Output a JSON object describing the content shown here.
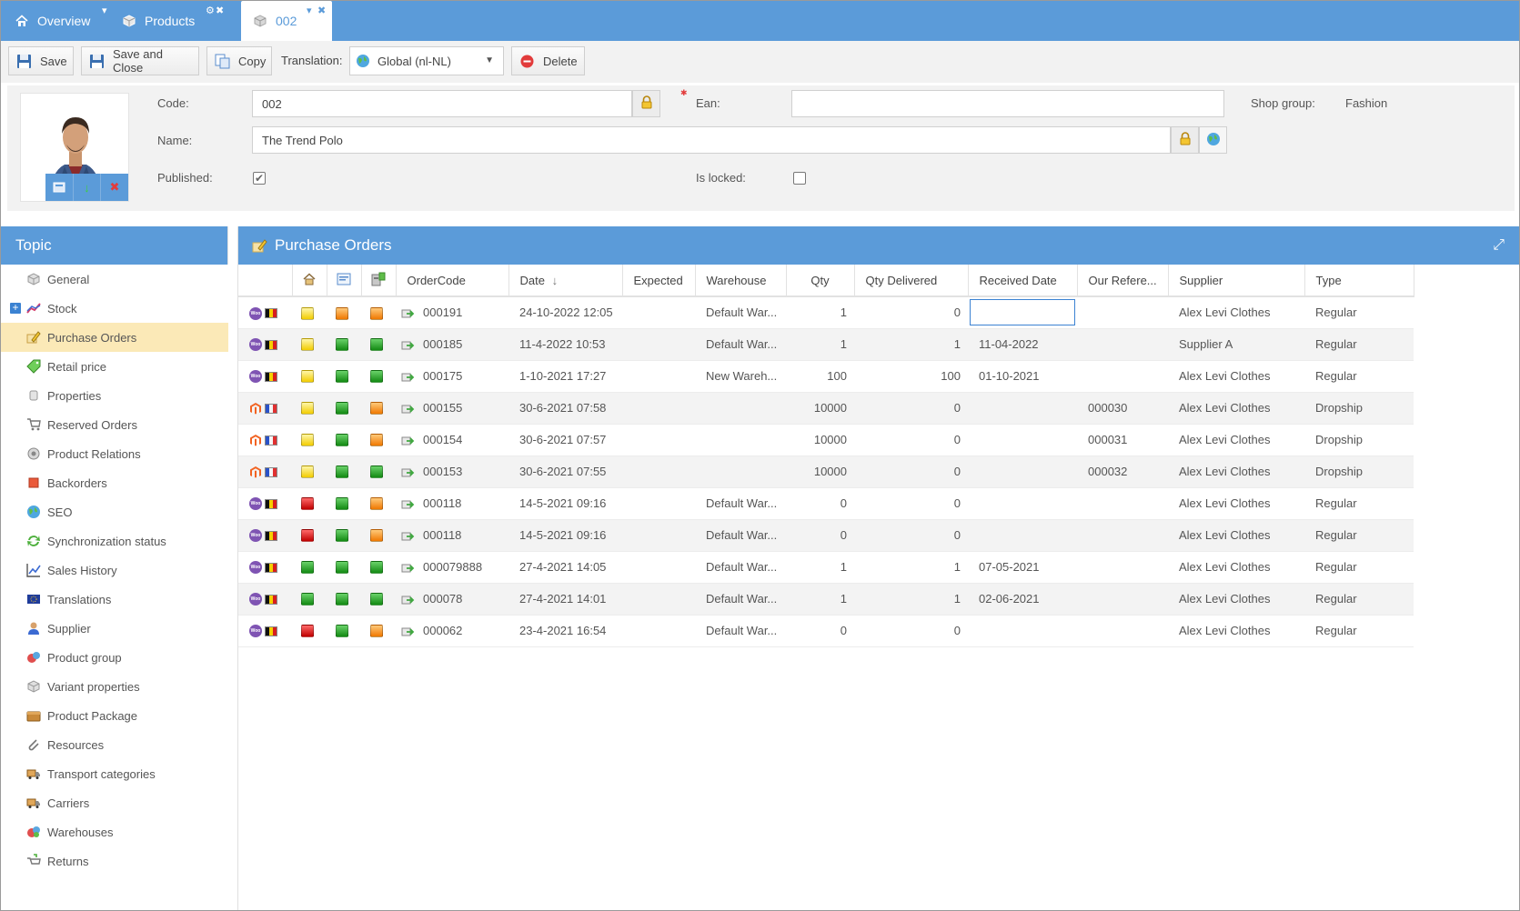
{
  "tabs": [
    {
      "label": "Overview",
      "icon": "home-icon"
    },
    {
      "label": "Products",
      "icon": "box-icon"
    },
    {
      "label": "002",
      "icon": "box-icon"
    }
  ],
  "toolbar": {
    "save_label": "Save",
    "save_close_label": "Save and Close",
    "copy_label": "Copy",
    "translation_label": "Translation:",
    "translation_value": "Global (nl-NL)",
    "delete_label": "Delete"
  },
  "product": {
    "code_label": "Code:",
    "code_value": "002",
    "ean_label": "Ean:",
    "ean_value": "",
    "shop_group_label": "Shop group:",
    "shop_group_value": "Fashion",
    "name_label": "Name:",
    "name_value": "The Trend Polo",
    "published_label": "Published:",
    "published_checked": true,
    "is_locked_label": "Is locked:",
    "is_locked_checked": false
  },
  "topic": {
    "title": "Topic",
    "items": [
      {
        "label": "General",
        "icon": "cube-icon"
      },
      {
        "label": "Stock",
        "icon": "chart-line-icon"
      },
      {
        "label": "Purchase Orders",
        "icon": "pencil-icon"
      },
      {
        "label": "Retail price",
        "icon": "price-tag-icon"
      },
      {
        "label": "Properties",
        "icon": "properties-icon"
      },
      {
        "label": "Reserved Orders",
        "icon": "cart-icon"
      },
      {
        "label": "Product Relations",
        "icon": "relations-icon"
      },
      {
        "label": "Backorders",
        "icon": "backorder-icon"
      },
      {
        "label": "SEO",
        "icon": "globe-icon"
      },
      {
        "label": "Synchronization status",
        "icon": "sync-icon"
      },
      {
        "label": "Sales History",
        "icon": "chart-icon"
      },
      {
        "label": "Translations",
        "icon": "flag-icon"
      },
      {
        "label": "Supplier",
        "icon": "user-icon"
      },
      {
        "label": "Product group",
        "icon": "group-icon"
      },
      {
        "label": "Variant properties",
        "icon": "cube-icon"
      },
      {
        "label": "Product Package",
        "icon": "package-icon"
      },
      {
        "label": "Resources",
        "icon": "paperclip-icon"
      },
      {
        "label": "Transport categories",
        "icon": "truck-icon"
      },
      {
        "label": "Carriers",
        "icon": "truck-icon"
      },
      {
        "label": "Warehouses",
        "icon": "warehouse-icon"
      },
      {
        "label": "Returns",
        "icon": "returns-icon"
      }
    ]
  },
  "purchase_orders": {
    "title": "Purchase Orders",
    "columns": [
      "OrderCode",
      "Date",
      "Expected",
      "Warehouse",
      "Qty",
      "Qty Delivered",
      "Received Date",
      "Our Refere...",
      "Supplier",
      "Type"
    ],
    "rows": [
      {
        "shop": "woo",
        "flag": "be",
        "s1": "yellow",
        "s2": "orange",
        "s3": "orange",
        "code": "000191",
        "date": "24-10-2022 12:05",
        "expected": "",
        "warehouse": "Default War...",
        "qty": "1",
        "qty_delivered": "0",
        "received": "",
        "ref": "",
        "supplier": "Alex Levi Clothes",
        "type": "Regular"
      },
      {
        "shop": "woo",
        "flag": "be",
        "s1": "yellow",
        "s2": "green",
        "s3": "green",
        "code": "000185",
        "date": "11-4-2022 10:53",
        "expected": "",
        "warehouse": "Default War...",
        "qty": "1",
        "qty_delivered": "1",
        "received": "11-04-2022",
        "ref": "",
        "supplier": "Supplier A",
        "type": "Regular"
      },
      {
        "shop": "woo",
        "flag": "be",
        "s1": "yellow",
        "s2": "green",
        "s3": "green",
        "code": "000175",
        "date": "1-10-2021 17:27",
        "expected": "",
        "warehouse": "New Wareh...",
        "qty": "100",
        "qty_delivered": "100",
        "received": "01-10-2021",
        "ref": "",
        "supplier": "Alex Levi Clothes",
        "type": "Regular"
      },
      {
        "shop": "magento",
        "flag": "fr",
        "s1": "yellow",
        "s2": "green",
        "s3": "orange",
        "code": "000155",
        "date": "30-6-2021 07:58",
        "expected": "",
        "warehouse": "",
        "qty": "10000",
        "qty_delivered": "0",
        "received": "",
        "ref": "000030",
        "supplier": "Alex Levi Clothes",
        "type": "Dropship"
      },
      {
        "shop": "magento",
        "flag": "fr",
        "s1": "yellow",
        "s2": "green",
        "s3": "orange",
        "code": "000154",
        "date": "30-6-2021 07:57",
        "expected": "",
        "warehouse": "",
        "qty": "10000",
        "qty_delivered": "0",
        "received": "",
        "ref": "000031",
        "supplier": "Alex Levi Clothes",
        "type": "Dropship"
      },
      {
        "shop": "magento",
        "flag": "fr",
        "s1": "yellow",
        "s2": "green",
        "s3": "green",
        "code": "000153",
        "date": "30-6-2021 07:55",
        "expected": "",
        "warehouse": "",
        "qty": "10000",
        "qty_delivered": "0",
        "received": "",
        "ref": "000032",
        "supplier": "Alex Levi Clothes",
        "type": "Dropship"
      },
      {
        "shop": "woo",
        "flag": "be",
        "s1": "red",
        "s2": "green",
        "s3": "orange",
        "code": "000118",
        "date": "14-5-2021 09:16",
        "expected": "",
        "warehouse": "Default War...",
        "qty": "0",
        "qty_delivered": "0",
        "received": "",
        "ref": "",
        "supplier": "Alex Levi Clothes",
        "type": "Regular"
      },
      {
        "shop": "woo",
        "flag": "be",
        "s1": "red",
        "s2": "green",
        "s3": "orange",
        "code": "000118",
        "date": "14-5-2021 09:16",
        "expected": "",
        "warehouse": "Default War...",
        "qty": "0",
        "qty_delivered": "0",
        "received": "",
        "ref": "",
        "supplier": "Alex Levi Clothes",
        "type": "Regular"
      },
      {
        "shop": "woo",
        "flag": "be",
        "s1": "green",
        "s2": "green",
        "s3": "green",
        "code": "000079888",
        "date": "27-4-2021 14:05",
        "expected": "",
        "warehouse": "Default War...",
        "qty": "1",
        "qty_delivered": "1",
        "received": "07-05-2021",
        "ref": "",
        "supplier": "Alex Levi Clothes",
        "type": "Regular"
      },
      {
        "shop": "woo",
        "flag": "be",
        "s1": "green",
        "s2": "green",
        "s3": "green",
        "code": "000078",
        "date": "27-4-2021 14:01",
        "expected": "",
        "warehouse": "Default War...",
        "qty": "1",
        "qty_delivered": "1",
        "received": "02-06-2021",
        "ref": "",
        "supplier": "Alex Levi Clothes",
        "type": "Regular"
      },
      {
        "shop": "woo",
        "flag": "be",
        "s1": "red",
        "s2": "green",
        "s3": "orange",
        "code": "000062",
        "date": "23-4-2021 16:54",
        "expected": "",
        "warehouse": "Default War...",
        "qty": "0",
        "qty_delivered": "0",
        "received": "",
        "ref": "",
        "supplier": "Alex Levi Clothes",
        "type": "Regular"
      }
    ]
  },
  "colors": {
    "accent": "#5b9bd9",
    "active_row": "#fbe9b7",
    "toolbar_bg": "#f2f2f2"
  }
}
